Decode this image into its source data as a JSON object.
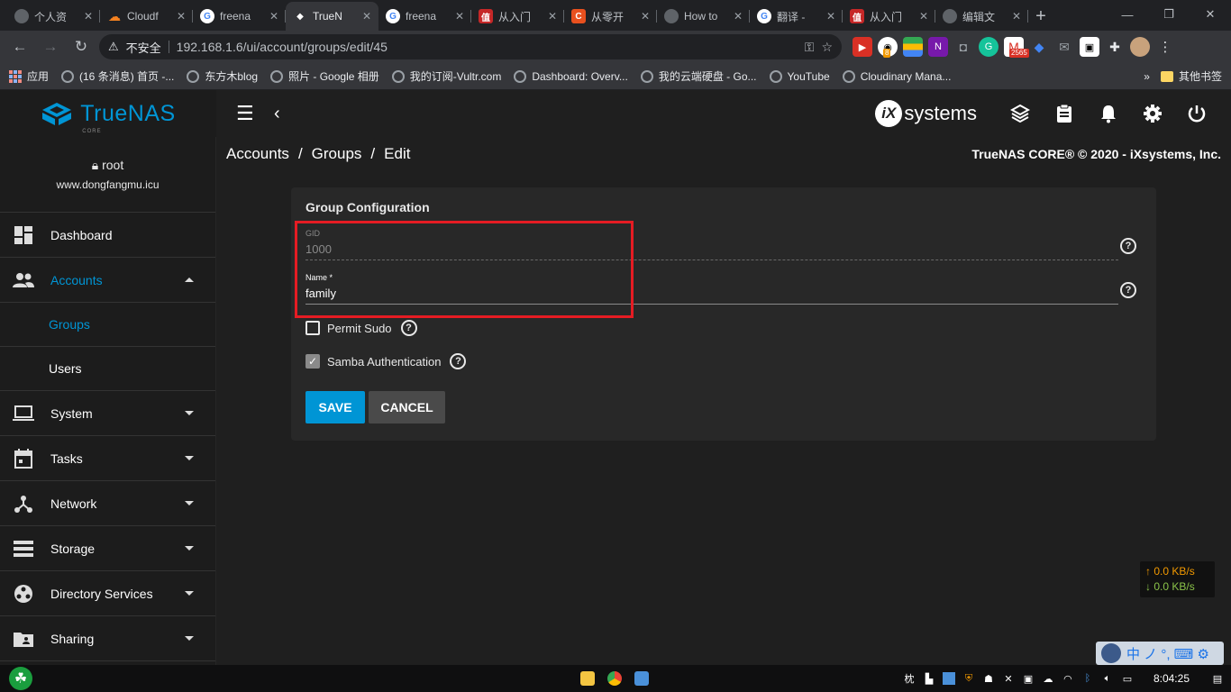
{
  "browser": {
    "tabs": [
      {
        "title": "个人资",
        "fav_color": "#5f6368",
        "fav_glyph": ""
      },
      {
        "title": "Cloudf",
        "fav_color": "#f48120",
        "fav_glyph": "☁"
      },
      {
        "title": "freena",
        "fav_color": "#4285f4",
        "fav_glyph": "G"
      },
      {
        "title": "TrueN",
        "fav_color": "#0095d5",
        "fav_glyph": "◆"
      },
      {
        "title": "freena",
        "fav_color": "#4285f4",
        "fav_glyph": "G"
      },
      {
        "title": "从入门",
        "fav_color": "#c62828",
        "fav_glyph": "值"
      },
      {
        "title": "从零开",
        "fav_color": "#e8501e",
        "fav_glyph": "C"
      },
      {
        "title": "How to",
        "fav_color": "#5f6368",
        "fav_glyph": ""
      },
      {
        "title": "翻译 -",
        "fav_color": "#4285f4",
        "fav_glyph": "G"
      },
      {
        "title": "从入门",
        "fav_color": "#c62828",
        "fav_glyph": "值"
      },
      {
        "title": "编辑文",
        "fav_color": "#5f6368",
        "fav_glyph": ""
      }
    ],
    "tab_close": "✕",
    "new_tab": "+",
    "window_controls": {
      "minimize": "—",
      "restore": "❐",
      "close": "✕"
    },
    "security_label": "不安全",
    "url": "192.168.1.6/ui/account/groups/edit/45",
    "extension_badges": {
      "ext2": "8",
      "ext5": "2565"
    },
    "bookmarks": [
      {
        "label": "应用"
      },
      {
        "label": "(16 条消息) 首页 -..."
      },
      {
        "label": "东方木blog"
      },
      {
        "label": "照片 - Google 相册"
      },
      {
        "label": "我的订阅-Vultr.com"
      },
      {
        "label": "Dashboard: Overv..."
      },
      {
        "label": "我的云端硬盘 - Go..."
      },
      {
        "label": "YouTube"
      },
      {
        "label": "Cloudinary Mana..."
      }
    ],
    "bookmarks_more": "»",
    "other_bookmarks": "其他书签"
  },
  "app": {
    "logo_text": "TrueNAS",
    "logo_sub": "CORE",
    "vendor_logo": "systems",
    "vendor_mark": "iX",
    "copyright": "TrueNAS CORE® © 2020 - iXsystems, Inc.",
    "breadcrumb": [
      "Accounts",
      "Groups",
      "Edit"
    ],
    "breadcrumb_sep": "/"
  },
  "sidebar": {
    "user": "root",
    "host": "www.dongfangmu.icu",
    "items": [
      {
        "label": "Dashboard",
        "icon": "dashboard-icon"
      },
      {
        "label": "Accounts",
        "icon": "people-icon",
        "expanded": true
      },
      {
        "label": "Groups",
        "sub": true,
        "active": true
      },
      {
        "label": "Users",
        "sub": true
      },
      {
        "label": "System",
        "icon": "computer-icon"
      },
      {
        "label": "Tasks",
        "icon": "calendar-icon"
      },
      {
        "label": "Network",
        "icon": "network-icon"
      },
      {
        "label": "Storage",
        "icon": "storage-icon"
      },
      {
        "label": "Directory Services",
        "icon": "directory-icon"
      },
      {
        "label": "Sharing",
        "icon": "folder-share-icon"
      }
    ]
  },
  "form": {
    "title": "Group Configuration",
    "gid_label": "GID",
    "gid_value": "1000",
    "name_label": "Name *",
    "name_value": "family",
    "help_glyph": "?",
    "permit_sudo_label": "Permit Sudo",
    "permit_sudo_checked": false,
    "samba_label": "Samba Authentication",
    "samba_checked": true,
    "check_glyph": "✓",
    "save_label": "SAVE",
    "cancel_label": "CANCEL"
  },
  "netspeed": {
    "up": "↑ 0.0 KB/s",
    "down": "↓ 0.0 KB/s"
  },
  "ime": {
    "text": "中 ノ °, ⌨ ⚙"
  },
  "taskbar": {
    "start_glyph": "☘",
    "tray_text_1": "枕",
    "clock": "8:04:25"
  },
  "colors": {
    "accent": "#0095d5",
    "highlight_box": "#e51c23",
    "card_bg": "#282828",
    "page_bg": "#1f1f1f"
  }
}
